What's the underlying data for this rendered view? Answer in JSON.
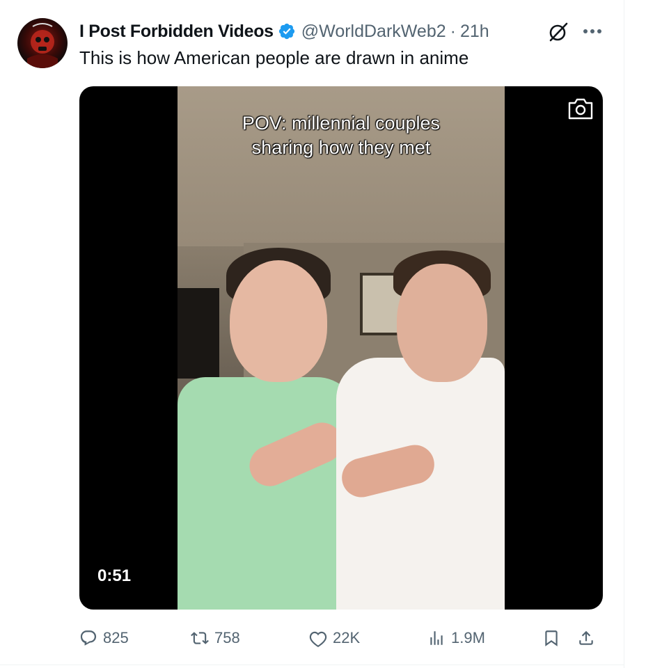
{
  "tweet": {
    "author_name": "I Post Forbidden Videos",
    "handle": "@WorldDarkWeb2",
    "separator": "·",
    "time": "21h",
    "text": "This is how American people are drawn in anime"
  },
  "media": {
    "overlay_text_line1": "POV: millennial couples",
    "overlay_text_line2": "sharing how they met",
    "duration": "0:51"
  },
  "actions": {
    "replies": "825",
    "reposts": "758",
    "likes": "22K",
    "views": "1.9M"
  },
  "icons": {
    "verified": "verified-badge-icon",
    "grok": "grok-icon",
    "more": "more-icon",
    "camera": "camera-icon",
    "reply": "reply-icon",
    "repost": "repost-icon",
    "like": "heart-icon",
    "views": "views-icon",
    "bookmark": "bookmark-icon",
    "share": "share-icon"
  },
  "colors": {
    "verified": "#1d9bf0",
    "secondary_text": "#536471",
    "text": "#0f1419"
  }
}
